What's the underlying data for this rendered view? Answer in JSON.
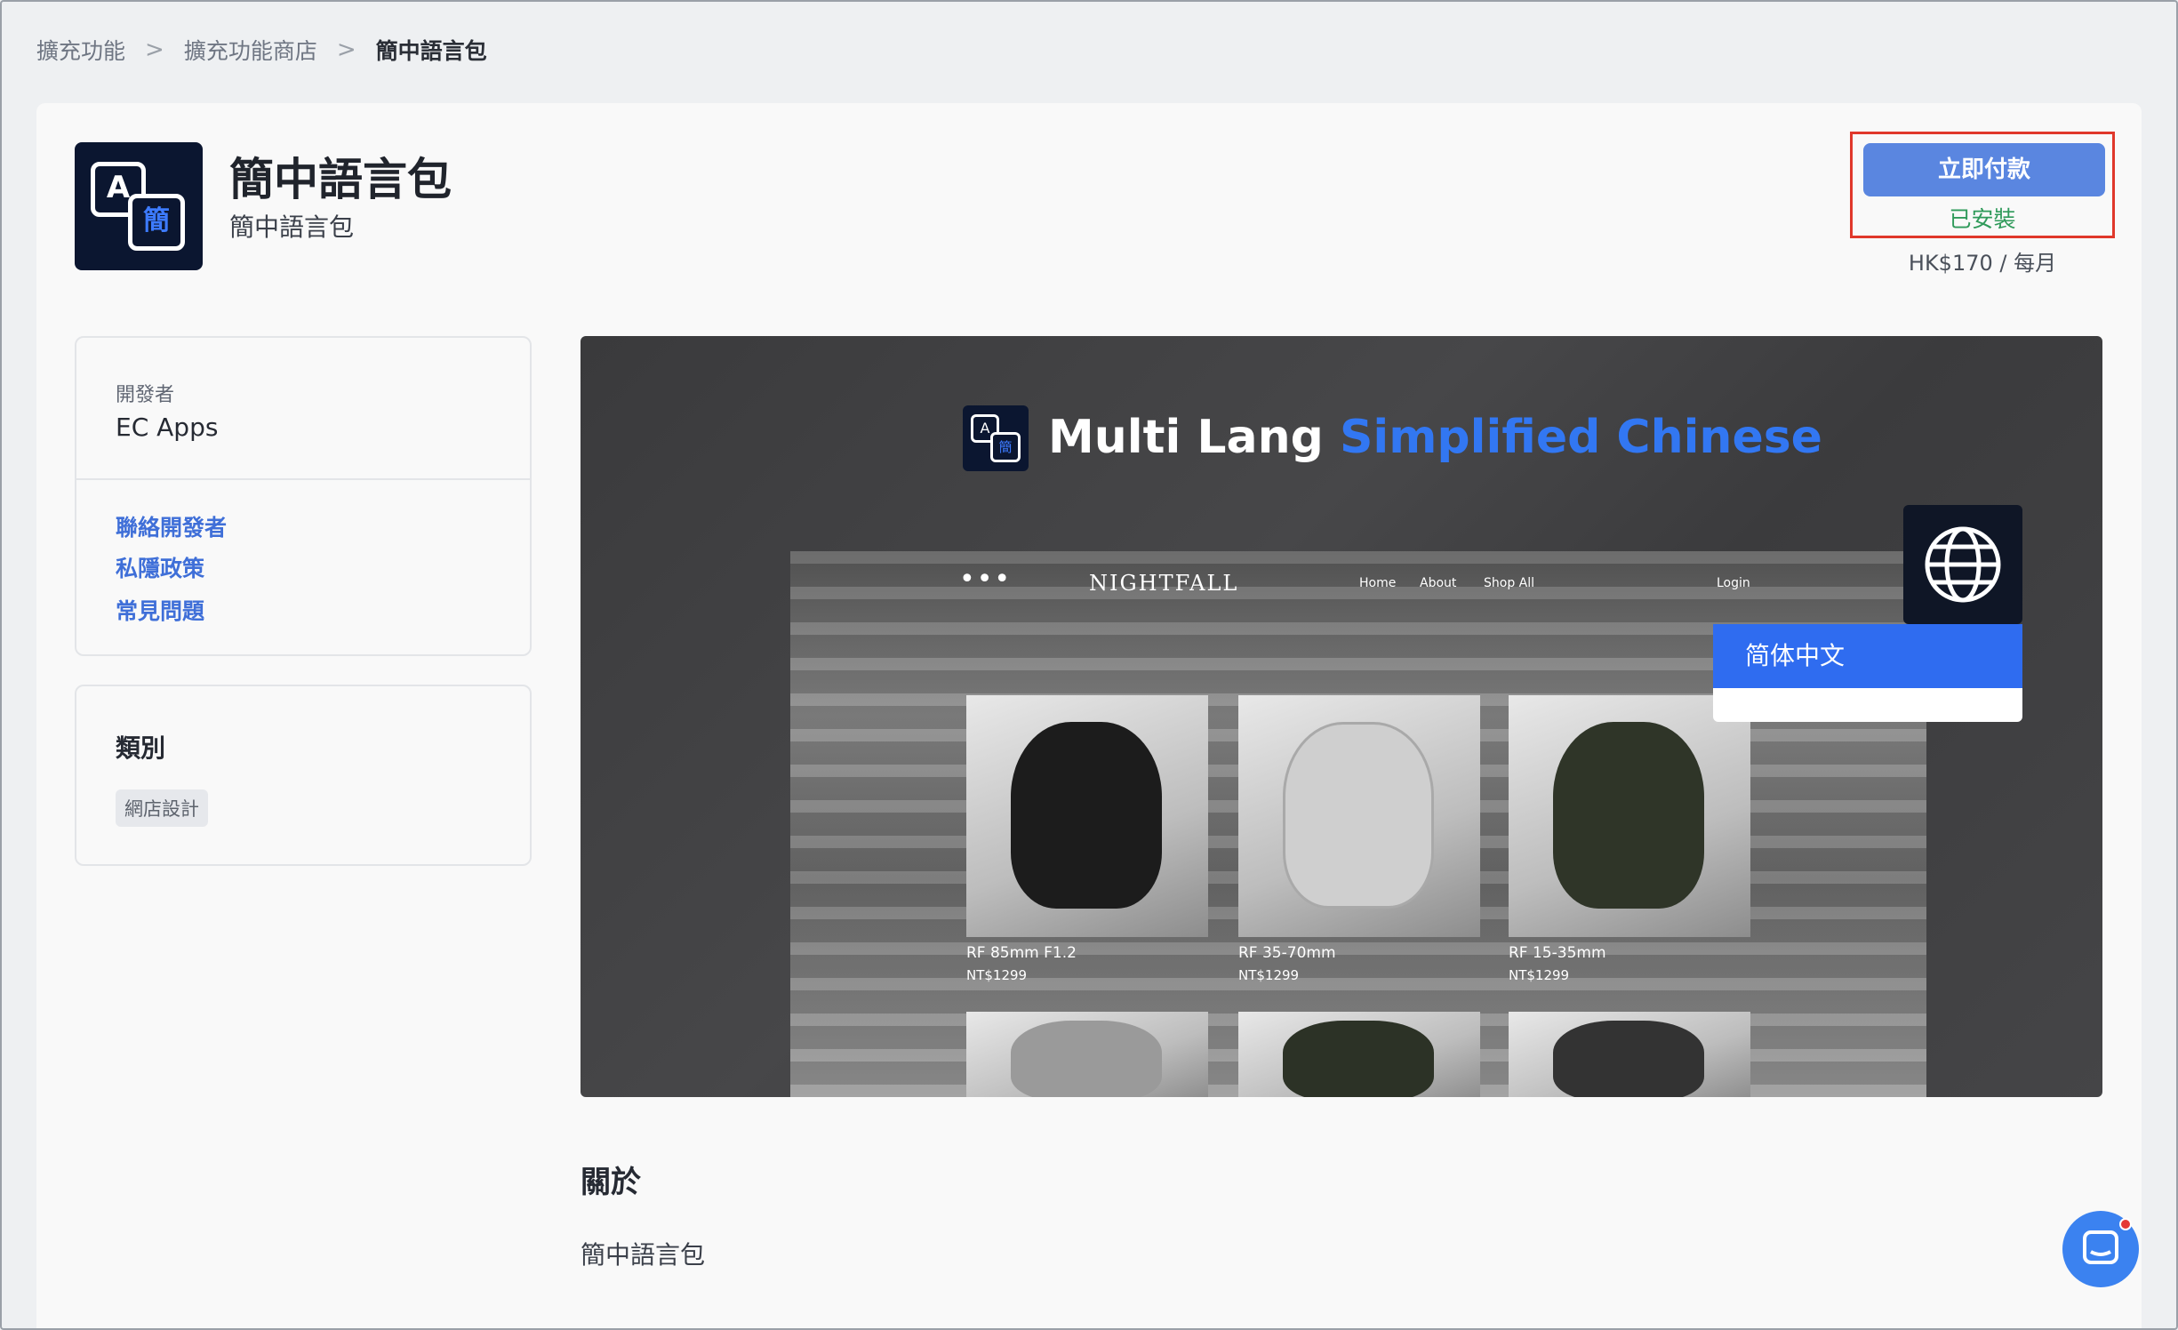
{
  "breadcrumb": {
    "items": [
      "擴充功能",
      "擴充功能商店",
      "簡中語言包"
    ],
    "separator": ">"
  },
  "app": {
    "icon_letter_top": "A",
    "icon_letter_bottom": "簡",
    "title": "簡中語言包",
    "subtitle": "簡中語言包"
  },
  "pricing": {
    "pay_button": "立即付款",
    "status": "已安裝",
    "price": "HK$170 / 每月"
  },
  "developer": {
    "label": "開發者",
    "name": "EC Apps",
    "links": [
      "聯絡開發者",
      "私隱政策",
      "常見問題"
    ]
  },
  "category": {
    "title": "類別",
    "tag": "網店設計"
  },
  "banner": {
    "heading_white": "Multi Lang",
    "heading_blue": "Simplified Chinese",
    "site": {
      "menu": "•••",
      "brand": "NIGHTFALL",
      "nav": [
        "Home",
        "About",
        "Shop All",
        "Login"
      ],
      "products": [
        {
          "name": "RF 85mm F1.2",
          "price": "NT$1299"
        },
        {
          "name": "RF 35-70mm",
          "price": "NT$1299"
        },
        {
          "name": "RF 15-35mm",
          "price": "NT$1299"
        }
      ]
    },
    "language_option": "简体中文",
    "globe_icon": "globe-icon"
  },
  "about": {
    "title": "關於",
    "body": "簡中語言包"
  },
  "colors": {
    "primary_button": "#5a86e0",
    "installed_green": "#2f9a5a",
    "link_blue": "#3f6fd8",
    "highlight_red": "#e0382b",
    "banner_blue": "#3277f2"
  }
}
